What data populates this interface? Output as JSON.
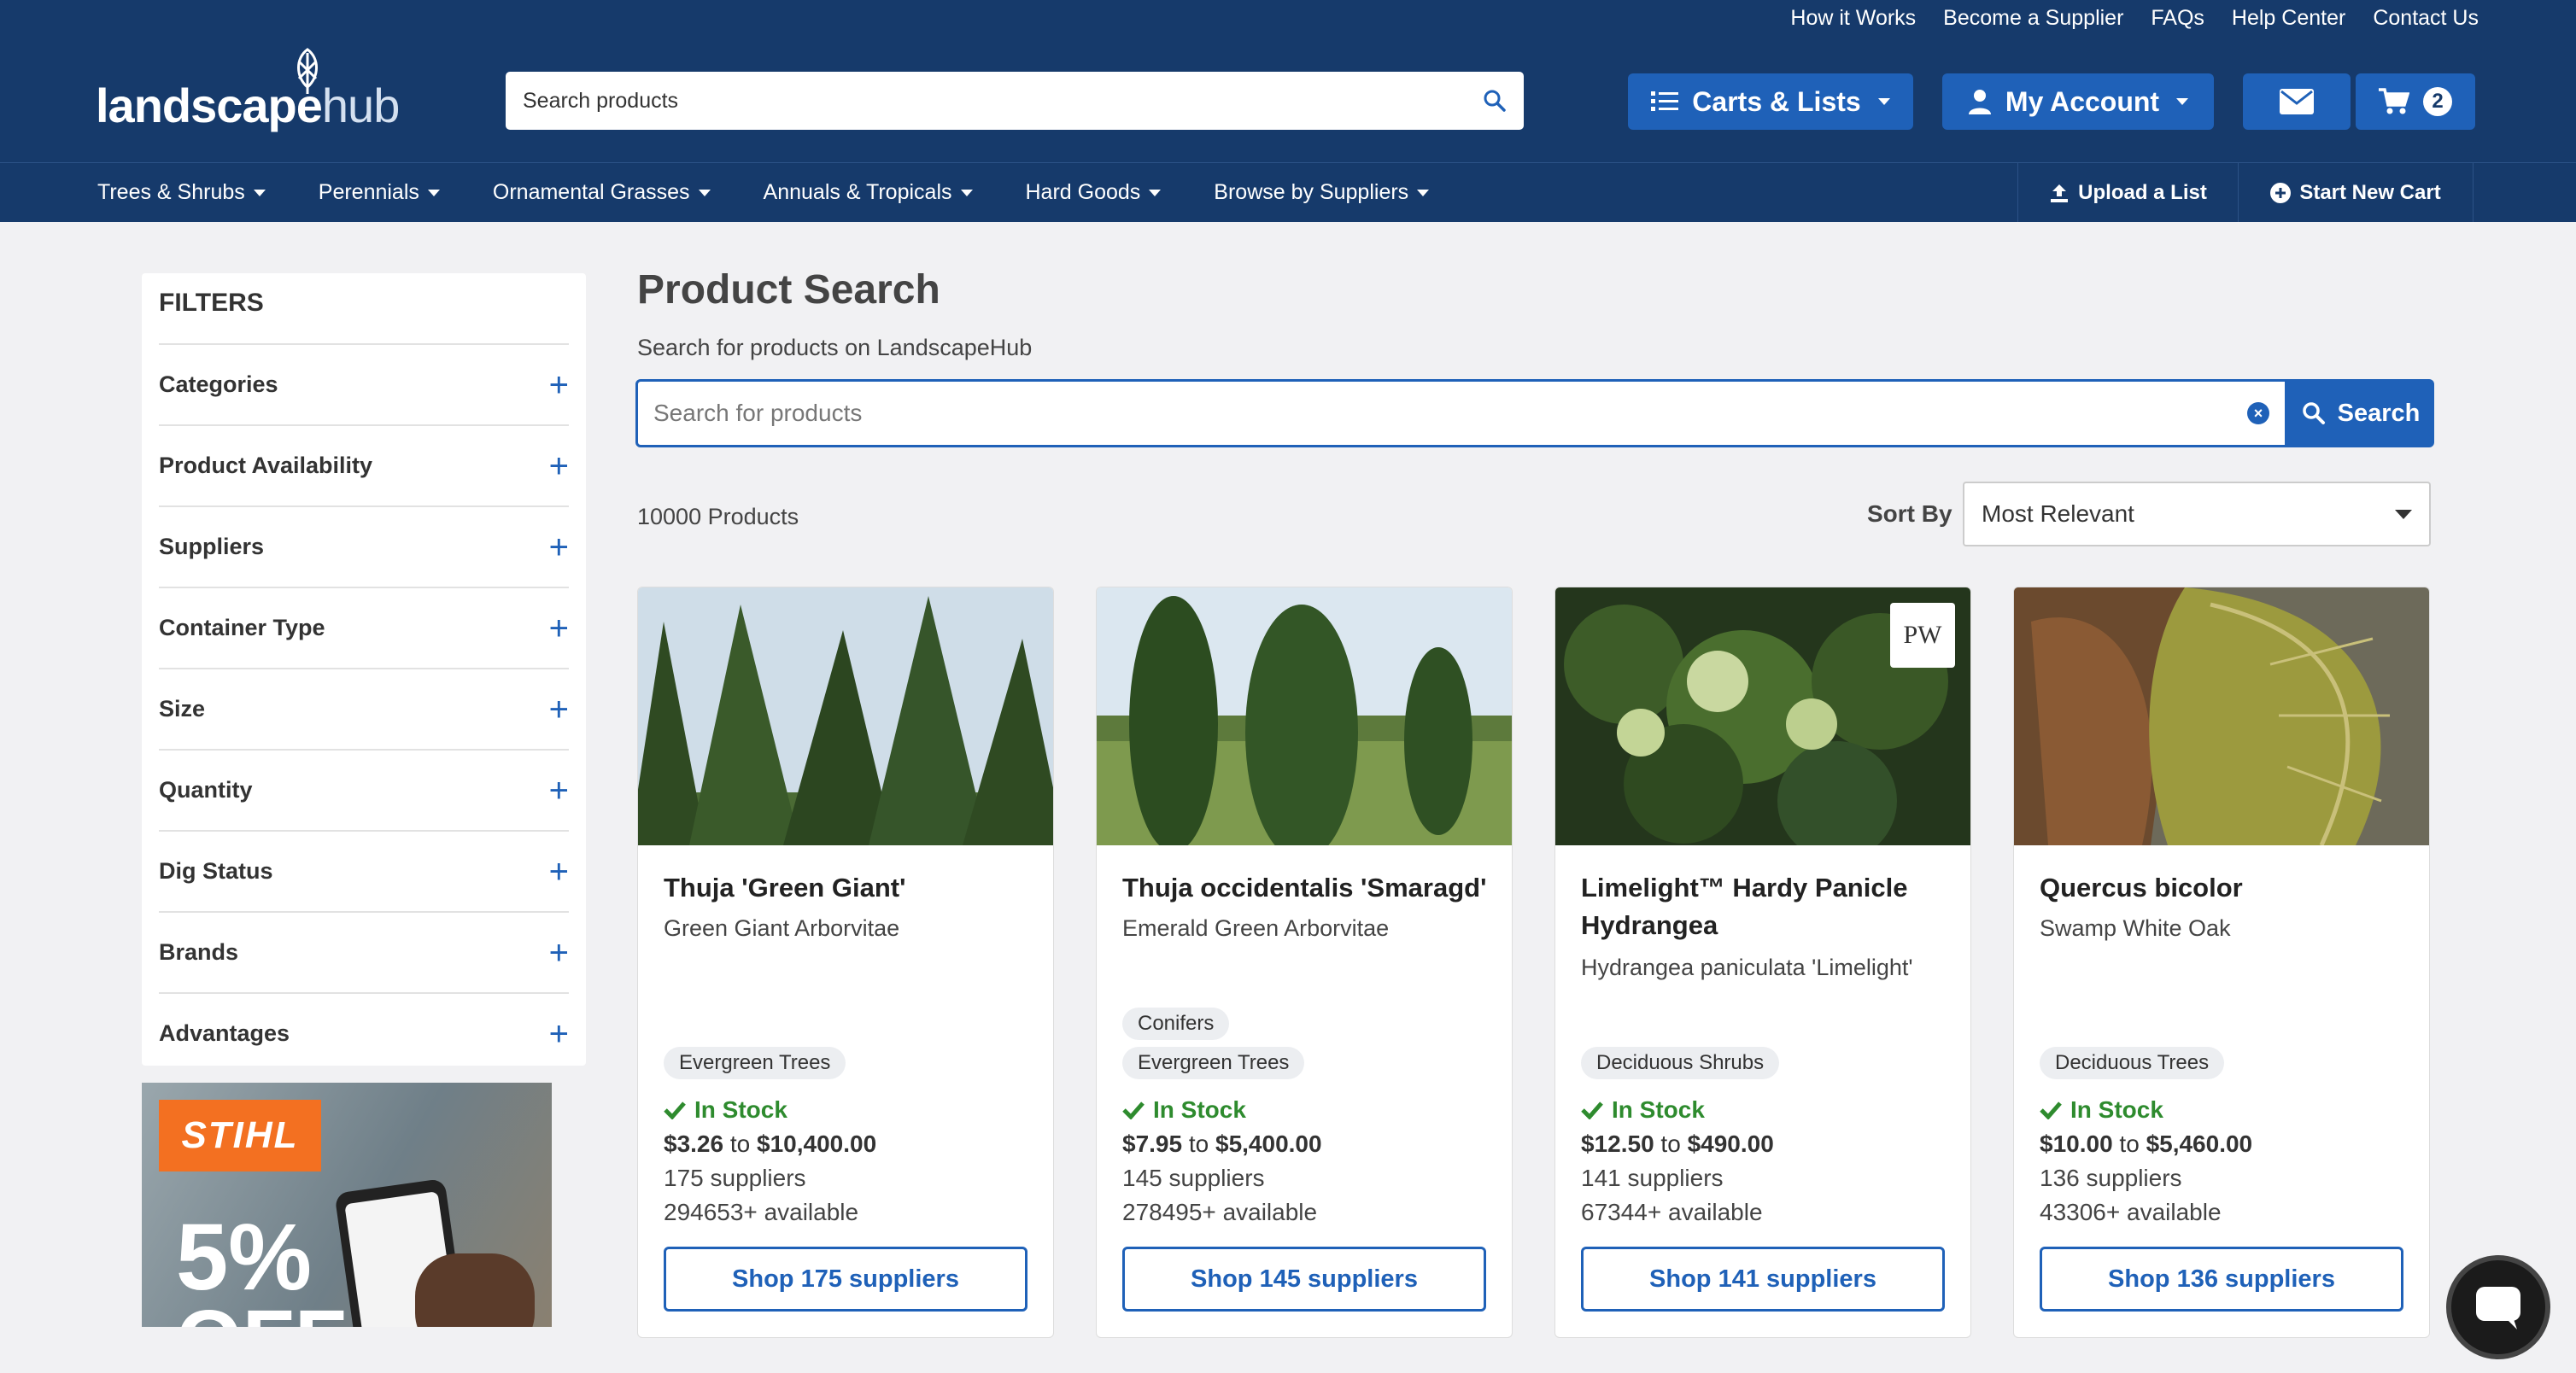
{
  "header": {
    "top_links": [
      "How it Works",
      "Become a Supplier",
      "FAQs",
      "Help Center",
      "Contact Us"
    ],
    "logo_text_bold": "landscape",
    "logo_text_light": "hub",
    "search_placeholder": "Search products",
    "carts_lists_label": "Carts & Lists",
    "my_account_label": "My Account",
    "cart_count": "2"
  },
  "category_nav": {
    "items": [
      "Trees & Shrubs",
      "Perennials",
      "Ornamental Grasses",
      "Annuals & Tropicals",
      "Hard Goods",
      "Browse by Suppliers"
    ],
    "upload_list": "Upload a List",
    "start_new_cart": "Start New Cart"
  },
  "filters": {
    "title": "FILTERS",
    "items": [
      "Categories",
      "Product Availability",
      "Suppliers",
      "Container Type",
      "Size",
      "Quantity",
      "Dig Status",
      "Brands",
      "Advantages"
    ]
  },
  "ad": {
    "brand": "STIHL",
    "headline": "5%",
    "subheadline": "OFF"
  },
  "main": {
    "title": "Product Search",
    "subtitle": "Search for products on LandscapeHub",
    "search_placeholder": "Search for products",
    "search_button": "Search",
    "product_count": "10000 Products",
    "sort_label": "Sort By",
    "sort_value": "Most Relevant"
  },
  "products": [
    {
      "name": "Thuja 'Green Giant'",
      "common": "Green Giant Arborvitae",
      "tags": [
        "Evergreen Trees"
      ],
      "stock": "In Stock",
      "price_low": "$3.26",
      "price_to": "to",
      "price_high": "$10,400.00",
      "suppliers": "175 suppliers",
      "available": "294653+ available",
      "button": "Shop 175 suppliers"
    },
    {
      "name": "Thuja occidentalis 'Smaragd'",
      "common": "Emerald Green Arborvitae",
      "tags": [
        "Conifers",
        "Evergreen Trees"
      ],
      "stock": "In Stock",
      "price_low": "$7.95",
      "price_to": "to",
      "price_high": "$5,400.00",
      "suppliers": "145 suppliers",
      "available": "278495+ available",
      "button": "Shop 145 suppliers"
    },
    {
      "name": "Limelight™ Hardy Panicle Hydrangea",
      "common": "Hydrangea paniculata 'Limelight'",
      "tags": [
        "Deciduous Shrubs"
      ],
      "stock": "In Stock",
      "price_low": "$12.50",
      "price_to": "to",
      "price_high": "$490.00",
      "suppliers": "141 suppliers",
      "available": "67344+ available",
      "button": "Shop 141 suppliers",
      "badge": "PW"
    },
    {
      "name": "Quercus bicolor",
      "common": "Swamp White Oak",
      "tags": [
        "Deciduous Trees"
      ],
      "stock": "In Stock",
      "price_low": "$10.00",
      "price_to": "to",
      "price_high": "$5,460.00",
      "suppliers": "136 suppliers",
      "available": "43306+ available",
      "button": "Shop 136 suppliers"
    }
  ],
  "colors": {
    "navy": "#163a6b",
    "accent": "#1f61b8",
    "in_stock": "#2e8b2e",
    "page_bg": "#f1f1f3"
  }
}
